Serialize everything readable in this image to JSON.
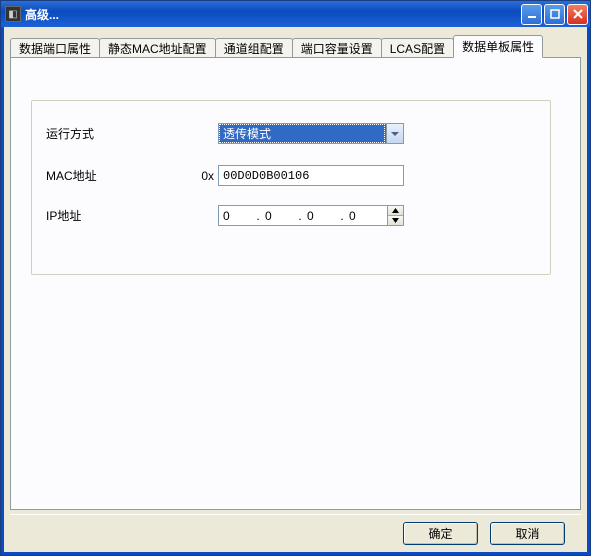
{
  "window": {
    "title": "高级..."
  },
  "tabs": [
    {
      "label": "数据端口属性",
      "active": false
    },
    {
      "label": "静态MAC地址配置",
      "active": false
    },
    {
      "label": "通道组配置",
      "active": false
    },
    {
      "label": "端口容量设置",
      "active": false
    },
    {
      "label": "LCAS配置",
      "active": false
    },
    {
      "label": "数据单板属性",
      "active": true
    }
  ],
  "form": {
    "run_mode_label": "运行方式",
    "run_mode_value": "透传模式",
    "mac_label": "MAC地址",
    "mac_prefix": "0x",
    "mac_value": "00D0D0B00106",
    "ip_label": "IP地址",
    "ip_octets": [
      "0",
      "0",
      "0",
      "0"
    ]
  },
  "buttons": {
    "ok": "确定",
    "cancel": "取消"
  }
}
